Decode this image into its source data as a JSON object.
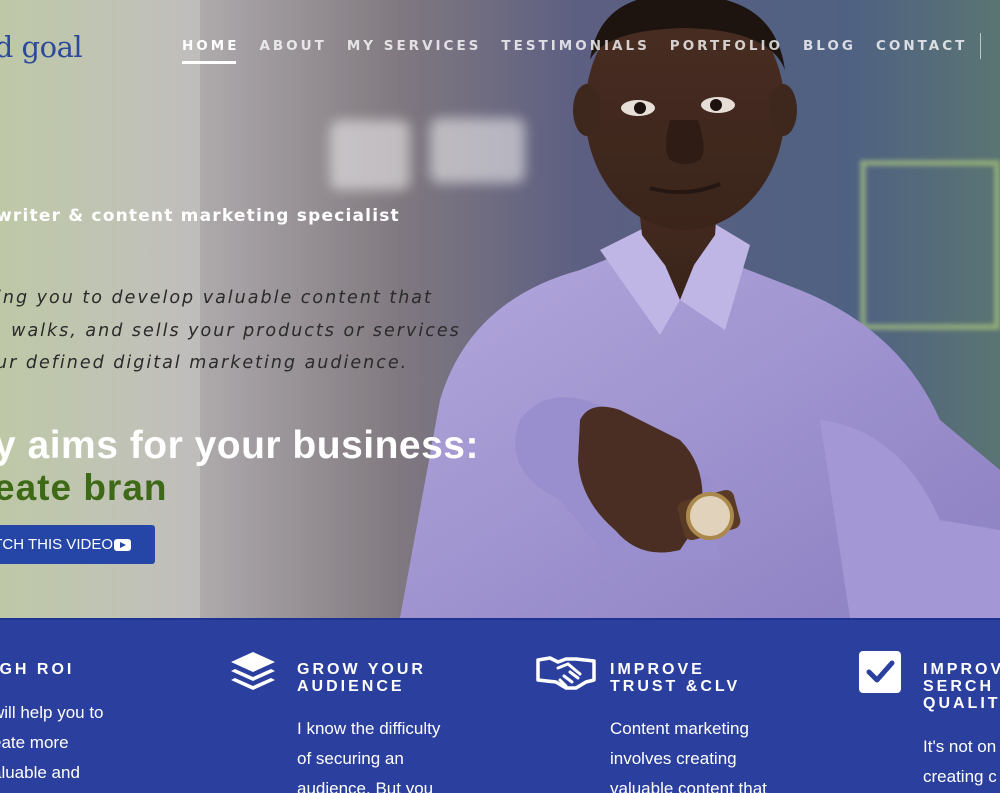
{
  "brand": {
    "logo_text": "id goal"
  },
  "nav": {
    "items": [
      {
        "label": "HOME",
        "active": true
      },
      {
        "label": "ABOUT",
        "active": false
      },
      {
        "label": "MY SERVICES",
        "active": false
      },
      {
        "label": "TESTIMONIALS",
        "active": false
      },
      {
        "label": "PORTFOLIO",
        "active": false
      },
      {
        "label": "BLOG",
        "active": false
      },
      {
        "label": "CONTACT",
        "active": false
      }
    ]
  },
  "hero": {
    "tagline": "writer & content marketing specialist",
    "intro_lines": [
      "ing you to develop valuable content that",
      ", walks, and sells your products or services",
      "ur defined digital marketing audience."
    ],
    "aims_heading": "y aims for your business:",
    "aims_rotating": "eate bran",
    "video_button_label": "TCH THIS VIDEO",
    "video_icon": "youtube-play-icon"
  },
  "features": [
    {
      "icon": "none",
      "title_lines": [
        "IGH ROI"
      ],
      "body_lines": [
        "will help you to",
        "eate more",
        "aluable and"
      ]
    },
    {
      "icon": "layers-icon",
      "title_lines": [
        "GROW YOUR",
        "AUDIENCE"
      ],
      "body_lines": [
        "I know the difficulty",
        "of securing an",
        "audience. But you"
      ]
    },
    {
      "icon": "handshake-icon",
      "title_lines": [
        "IMPROVE",
        "TRUST &CLV"
      ],
      "body_lines": [
        "Content marketing",
        "involves creating",
        "valuable content that"
      ]
    },
    {
      "icon": "checkbox-icon",
      "title_lines": [
        "IMPROV",
        "SERCH",
        "QUALIT"
      ],
      "body_lines": [
        "It's not on",
        "creating c"
      ]
    }
  ],
  "colors": {
    "accent_blue": "#2a3f9e",
    "button_blue": "#2546a6",
    "rotating_text_green": "#3e6a17",
    "logo_blue": "#2d4a9a"
  }
}
